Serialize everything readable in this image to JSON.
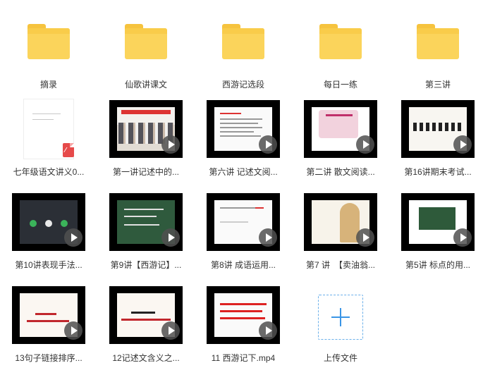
{
  "folders": [
    {
      "label": "摘录"
    },
    {
      "label": "仙歌讲课文"
    },
    {
      "label": "西游记选段"
    },
    {
      "label": "每日一练"
    },
    {
      "label": "第三讲"
    }
  ],
  "files": [
    {
      "label": "七年级语文讲义0...",
      "type": "pdf",
      "icon": "pdf-icon"
    },
    {
      "label": "第一讲记述中的...",
      "type": "video"
    },
    {
      "label": "第六讲 记述文阅...",
      "type": "video"
    },
    {
      "label": "第二讲 散文阅读...",
      "type": "video"
    },
    {
      "label": "第16讲期末考试...",
      "type": "video"
    },
    {
      "label": "第10讲表现手法...",
      "type": "video"
    },
    {
      "label": "第9讲【西游记】...",
      "type": "video"
    },
    {
      "label": "第8讲 成语运用...",
      "type": "video"
    },
    {
      "label": "第7 讲　【卖油翁...",
      "type": "video"
    },
    {
      "label": "第5讲 标点的用...",
      "type": "video"
    },
    {
      "label": "13句子链接排序...",
      "type": "video"
    },
    {
      "label": "12记述文含义之...",
      "type": "video"
    },
    {
      "label": "11 西游记下.mp4",
      "type": "video"
    }
  ],
  "upload": {
    "label": "上传文件",
    "icon": "plus-icon"
  },
  "colors": {
    "folder": "#fbd45b",
    "folder_tab": "#f6c33e",
    "accent": "#3a95e6",
    "pdf": "#e64a4a"
  }
}
